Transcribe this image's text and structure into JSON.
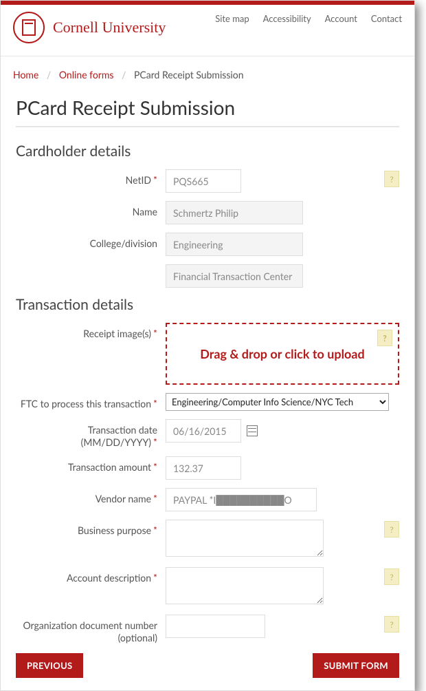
{
  "brand": {
    "name": "Cornell University"
  },
  "topnav": {
    "sitemap": "Site map",
    "accessibility": "Accessibility",
    "account": "Account",
    "contact": "Contact"
  },
  "crumbs": {
    "home": "Home",
    "forms": "Online forms",
    "current": "PCard Receipt Submission"
  },
  "page": {
    "title": "PCard Receipt Submission"
  },
  "cardholder": {
    "heading": "Cardholder details",
    "netid_label": "NetID",
    "netid_value": "PQS665",
    "name_label": "Name",
    "name_value": "Schmertz Philip",
    "division_label": "College/division",
    "division_value": "Engineering",
    "ftc_value": "Financial Transaction Center"
  },
  "transaction": {
    "heading": "Transaction details",
    "receipt_label": "Receipt image(s)",
    "dropzone_text": "Drag & drop or click to upload",
    "ftc_label": "FTC to process this transaction",
    "ftc_selected": "Engineering/Computer Info Science/NYC Tech",
    "date_label": "Transaction date (MM/DD/YYYY)",
    "date_value": "06/16/2015",
    "amount_label": "Transaction amount",
    "amount_value": "132.37",
    "vendor_label": "Vendor name",
    "vendor_value": "PAYPAL *I██████████O",
    "purpose_label": "Business purpose",
    "purpose_value": "",
    "account_label": "Account description",
    "account_value": "",
    "orgdoc_label": "Organization document number (optional)",
    "orgdoc_value": ""
  },
  "buttons": {
    "previous": "PREVIOUS",
    "submit": "SUBMIT FORM"
  },
  "help_glyph": "?"
}
